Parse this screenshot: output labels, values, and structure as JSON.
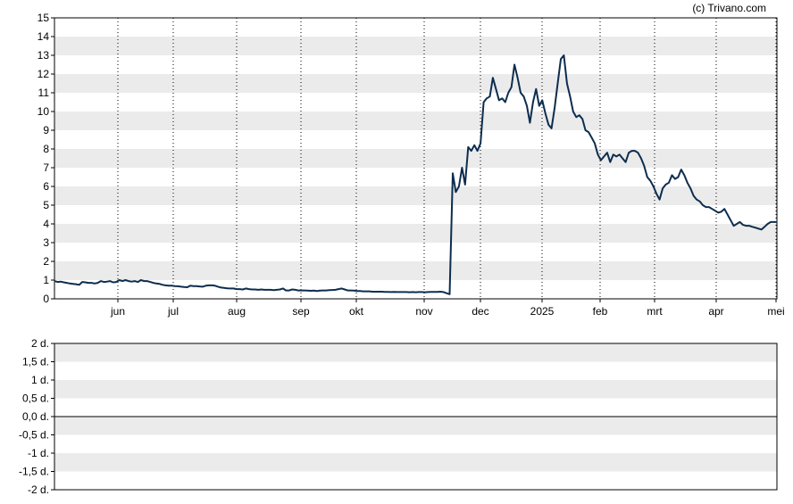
{
  "watermark": "(c) Trivano.com",
  "chart_data": [
    {
      "type": "line",
      "name": "price",
      "ylim": [
        0,
        15
      ],
      "y_ticks": [
        "0",
        "1",
        "2",
        "3",
        "4",
        "5",
        "6",
        "7",
        "8",
        "9",
        "10",
        "11",
        "12",
        "13",
        "14",
        "15"
      ],
      "x_ticks": [
        "jun",
        "jul",
        "aug",
        "sep",
        "okt",
        "nov",
        "dec",
        "2025",
        "feb",
        "mrt",
        "apr",
        "mei"
      ],
      "grid": "horizontal bands alternating, dotted vertical month lines",
      "line_color": "#0d2d4f",
      "series": [
        {
          "values": [
            0.95,
            0.9,
            0.92,
            0.88,
            0.85,
            0.82,
            0.8,
            0.78,
            0.75,
            0.9,
            0.88,
            0.85,
            0.85,
            0.82,
            0.85,
            0.95,
            0.9,
            0.92,
            0.95,
            0.88,
            0.9,
            1.0,
            0.95,
            1.0,
            0.95,
            0.92,
            0.95,
            0.9,
            1.0,
            0.95,
            0.95,
            0.9,
            0.85,
            0.82,
            0.8,
            0.75,
            0.72,
            0.7,
            0.7,
            0.68,
            0.67,
            0.65,
            0.63,
            0.62,
            0.7,
            0.68,
            0.68,
            0.66,
            0.65,
            0.7,
            0.72,
            0.72,
            0.7,
            0.65,
            0.6,
            0.58,
            0.56,
            0.55,
            0.55,
            0.52,
            0.52,
            0.5,
            0.55,
            0.52,
            0.5,
            0.5,
            0.48,
            0.5,
            0.48,
            0.48,
            0.48,
            0.46,
            0.48,
            0.5,
            0.55,
            0.45,
            0.45,
            0.5,
            0.48,
            0.45,
            0.45,
            0.45,
            0.44,
            0.43,
            0.44,
            0.42,
            0.44,
            0.45,
            0.45,
            0.46,
            0.47,
            0.48,
            0.52,
            0.55,
            0.5,
            0.45,
            0.45,
            0.44,
            0.42,
            0.42,
            0.4,
            0.4,
            0.4,
            0.38,
            0.38,
            0.38,
            0.38,
            0.37,
            0.37,
            0.36,
            0.37,
            0.36,
            0.36,
            0.36,
            0.36,
            0.35,
            0.36,
            0.35,
            0.36,
            0.36,
            0.35,
            0.36,
            0.37,
            0.37,
            0.37,
            0.38,
            0.36,
            0.3,
            0.25,
            6.7,
            5.7,
            6.0,
            7.0,
            6.1,
            8.1,
            7.9,
            8.2,
            7.9,
            8.3,
            10.5,
            10.7,
            10.8,
            11.8,
            11.2,
            10.6,
            10.7,
            10.5,
            11.0,
            11.3,
            12.5,
            11.8,
            11.0,
            10.8,
            10.3,
            9.4,
            10.5,
            11.2,
            10.3,
            10.6,
            9.9,
            9.3,
            9.1,
            10.2,
            11.5,
            12.8,
            13.0,
            11.5,
            10.8,
            10.0,
            9.7,
            9.8,
            9.6,
            9.0,
            8.9,
            8.6,
            8.3,
            7.7,
            7.4,
            7.6,
            7.8,
            7.3,
            7.7,
            7.6,
            7.7,
            7.5,
            7.3,
            7.8,
            7.9,
            7.9,
            7.8,
            7.5,
            7.1,
            6.5,
            6.3,
            6.0,
            5.6,
            5.3,
            5.9,
            6.1,
            6.2,
            6.6,
            6.4,
            6.5,
            6.9,
            6.6,
            6.2,
            5.9,
            5.5,
            5.3,
            5.2,
            5.0,
            4.9,
            4.9,
            4.8,
            4.7,
            4.6,
            4.65,
            4.8,
            4.5,
            4.2,
            3.9,
            4.0,
            4.1,
            3.95,
            3.9,
            3.9,
            3.85,
            3.8,
            3.75,
            3.7,
            3.85,
            4.0,
            4.1,
            4.1,
            4.1
          ]
        }
      ]
    },
    {
      "type": "line",
      "name": "volume",
      "ylim": [
        -2,
        2
      ],
      "y_ticks": [
        "-2 d.",
        "-1,5 d.",
        "-1 d.",
        "-0,5 d.",
        "0,0 d.",
        "0,5 d.",
        "1 d.",
        "1,5 d.",
        "2 d."
      ],
      "grid": "horizontal bands alternating",
      "series": [
        {
          "values": []
        }
      ]
    }
  ]
}
